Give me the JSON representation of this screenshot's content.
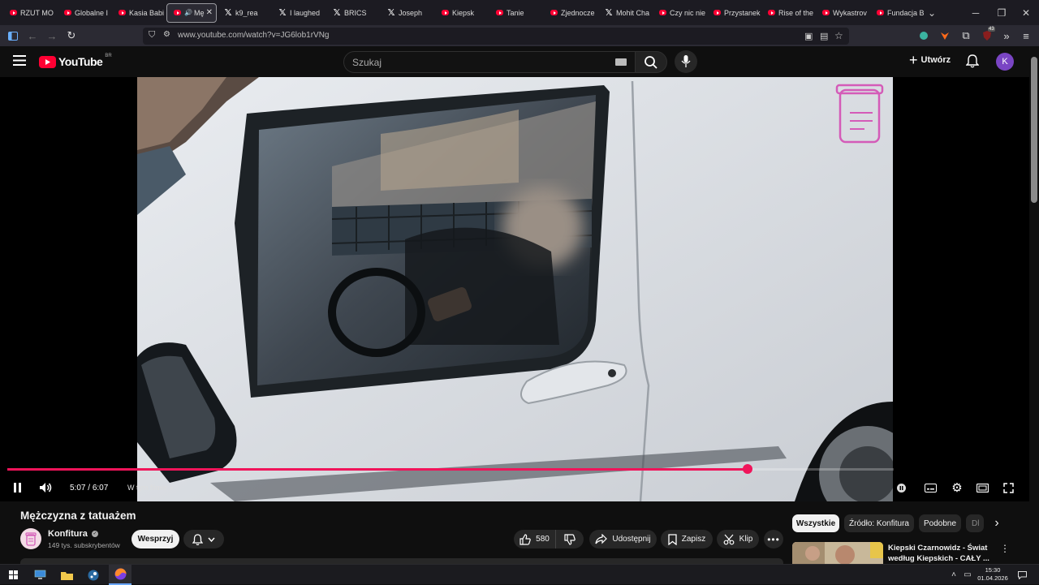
{
  "browser": {
    "tabs": [
      {
        "title": "RZUT MO",
        "icon": "youtube-icon"
      },
      {
        "title": "Globalne I",
        "icon": "youtube-icon"
      },
      {
        "title": "Kasia Babi",
        "icon": "youtube-icon"
      },
      {
        "title": "Mę",
        "icon": "youtube-icon",
        "active": true
      },
      {
        "title": "k9_rea",
        "icon": "x-icon"
      },
      {
        "title": "I laughed",
        "icon": "x-icon"
      },
      {
        "title": "BRICS",
        "icon": "x-icon"
      },
      {
        "title": "Joseph",
        "icon": "x-icon"
      },
      {
        "title": "Kiepsk",
        "icon": "youtube-icon"
      },
      {
        "title": "Tanie",
        "icon": "youtube-icon"
      },
      {
        "title": "Zjednocze",
        "icon": "youtube-icon"
      },
      {
        "title": "Mohit Cha",
        "icon": "x-icon"
      },
      {
        "title": "Czy nic nie",
        "icon": "youtube-icon"
      },
      {
        "title": "Przystanek",
        "icon": "youtube-icon"
      },
      {
        "title": "Rise of the",
        "icon": "youtube-icon"
      },
      {
        "title": "Wykastrov",
        "icon": "youtube-icon"
      },
      {
        "title": "Fundacja B",
        "icon": "youtube-icon"
      }
    ],
    "url": "www.youtube.com/watch?v=JG6lob1rVNg",
    "extension_badge": "43"
  },
  "youtube": {
    "logo_text": "YouTube",
    "region": "BR",
    "search_placeholder": "Szukaj",
    "create_label": "Utwórz",
    "avatar_letter": "K"
  },
  "player": {
    "time_current": "5:07",
    "time_separator": " / ",
    "time_total": "6:07",
    "progress_fraction": 0.835,
    "in_this_video": "W tym filmie",
    "accent_color": "#f0145a"
  },
  "video": {
    "title": "Mężczyzna z tatuażem",
    "channel": "Konfitura",
    "subscribers": "149 tys. subskrybentów",
    "support_label": "Wesprzyj",
    "likes": "580",
    "share_label": "Udostępnij",
    "save_label": "Zapisz",
    "clip_label": "Klip"
  },
  "recommendations": {
    "chips": [
      "Wszystkie",
      "Źródło: Konfitura",
      "Podobne",
      "Dl"
    ],
    "first_title": "Kiepski Czarnowidz - Świat według Kiepskich - CAŁY ..."
  },
  "taskbar": {
    "time": "15:30",
    "date": "01.04.2026"
  }
}
